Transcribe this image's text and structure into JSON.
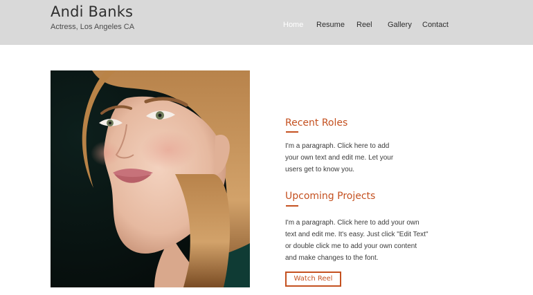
{
  "header": {
    "title": "Andi Banks",
    "subtitle": "Actress, Los Angeles CA"
  },
  "nav": {
    "items": [
      {
        "label": "Home",
        "active": true
      },
      {
        "label": "Resume",
        "active": false
      },
      {
        "label": "Reel",
        "active": false
      },
      {
        "label": "Gallery",
        "active": false
      },
      {
        "label": "Contact",
        "active": false
      }
    ]
  },
  "main": {
    "recent_roles": {
      "heading": "Recent Roles",
      "lines": [
        "I'm a paragraph. Click here to add",
        "your own text and edit me. Let your",
        "users get to know you."
      ]
    },
    "upcoming_projects": {
      "heading": "Upcoming Projects",
      "lines": [
        "I'm a paragraph. Click here to add your own",
        "text and edit me. It's easy. Just click \"Edit Text\"",
        "or double click me to add your own content",
        "and make changes to the font."
      ]
    },
    "cta_label": "Watch Reel"
  },
  "colors": {
    "header_bg": "#d9d9d9",
    "accent": "#c4501f",
    "nav_active": "#ffffff",
    "text": "#2e2e2e"
  },
  "icons": {
    "photo": "portrait-photo"
  }
}
